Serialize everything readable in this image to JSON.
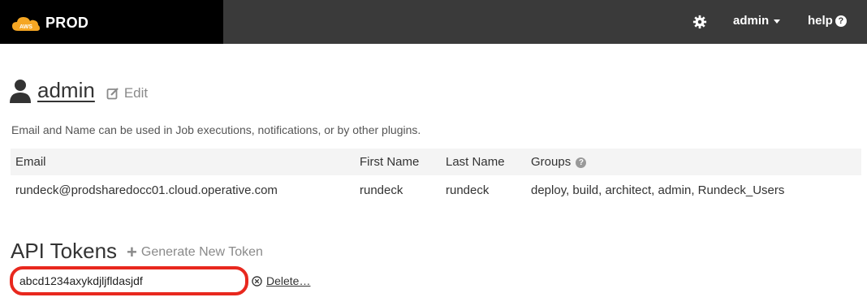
{
  "topbar": {
    "brand_text": "PROD",
    "logo_text": "AWS",
    "admin_label": "admin",
    "help_label": "help",
    "colors": {
      "bar": "#3a3a3a",
      "brand_bg": "#000000",
      "logo_orange": "#f5a623"
    }
  },
  "profile": {
    "username": "admin",
    "edit_label": "Edit",
    "note": "Email and Name can be used in Job executions, notifications, or by other plugins."
  },
  "user_table": {
    "headers": [
      "Email",
      "First Name",
      "Last Name",
      "Groups"
    ],
    "row": {
      "email": "rundeck@prodsharedocc01.cloud.operative.com",
      "first_name": "rundeck",
      "last_name": "rundeck",
      "groups": "deploy, build, architect, admin, Rundeck_Users"
    }
  },
  "api_tokens": {
    "title": "API Tokens",
    "generate_label": "Generate New Token",
    "token_value": "abcd1234axykdjljfldasjdf",
    "delete_label": "Delete…",
    "highlight_color": "#e8281e"
  }
}
